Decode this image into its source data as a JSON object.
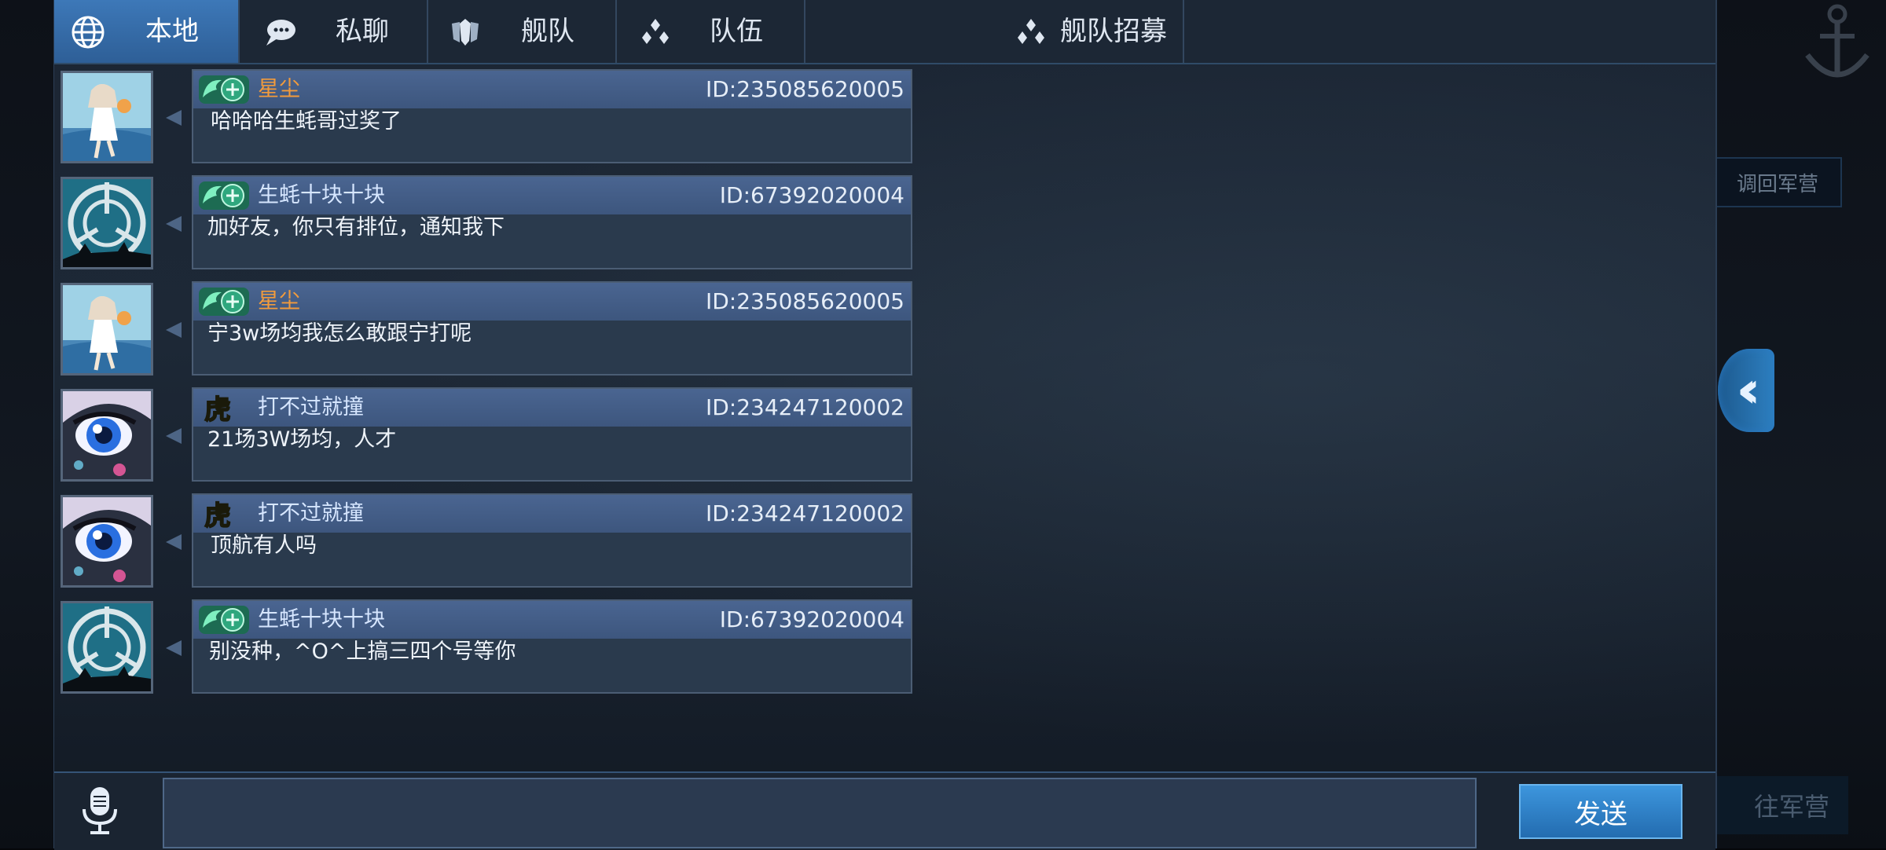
{
  "tabs": [
    {
      "label": "本地",
      "icon": "globe-icon",
      "active": true
    },
    {
      "label": "私聊",
      "icon": "chat-bubble-icon",
      "active": false
    },
    {
      "label": "舰队",
      "icon": "fleet-shield-icon",
      "active": false
    },
    {
      "label": "队伍",
      "icon": "team-dots-icon",
      "active": false
    },
    {
      "label": "舰队招募",
      "icon": "team-dots-icon",
      "active": false
    }
  ],
  "messages": [
    {
      "name": "星尘",
      "id": "ID:235085620005",
      "text": "哈哈哈生蚝哥过奖了",
      "badge": "dragon-badge-icon",
      "avatar": "anime-girl-beach-avatar",
      "name_color": "orange"
    },
    {
      "name": "生蚝十块十块",
      "id": "ID:67392020004",
      "text": "加好友，你只有排位，通知我下",
      "badge": "dragon-badge-icon",
      "avatar": "crosshair-ship-avatar",
      "name_color": "blue"
    },
    {
      "name": "星尘",
      "id": "ID:235085620005",
      "text": "宁3w场均我怎么敢跟宁打呢",
      "badge": "dragon-badge-icon",
      "avatar": "anime-girl-beach-avatar",
      "name_color": "orange"
    },
    {
      "name": "打不过就撞",
      "id": "ID:234247120002",
      "text": "21场3W场均，人才",
      "badge": "tiger-badge-icon",
      "avatar": "anime-eye-avatar",
      "name_color": "blue"
    },
    {
      "name": "打不过就撞",
      "id": "ID:234247120002",
      "text": "顶航有人吗",
      "badge": "tiger-badge-icon",
      "avatar": "anime-eye-avatar",
      "name_color": "blue"
    },
    {
      "name": "生蚝十块十块",
      "id": "ID:67392020004",
      "text": "别没种，^O^上搞三四个号等你",
      "badge": "dragon-badge-icon",
      "avatar": "crosshair-ship-avatar",
      "name_color": "blue"
    }
  ],
  "input": {
    "value": "",
    "placeholder": ""
  },
  "send_label": "发送",
  "background": {
    "recall_label": "调回军营",
    "goto_label": "往军营"
  },
  "colors": {
    "accent_blue": "#2e6fb0",
    "name_orange": "#f29b3c",
    "panel_bg": "#1d2836"
  }
}
